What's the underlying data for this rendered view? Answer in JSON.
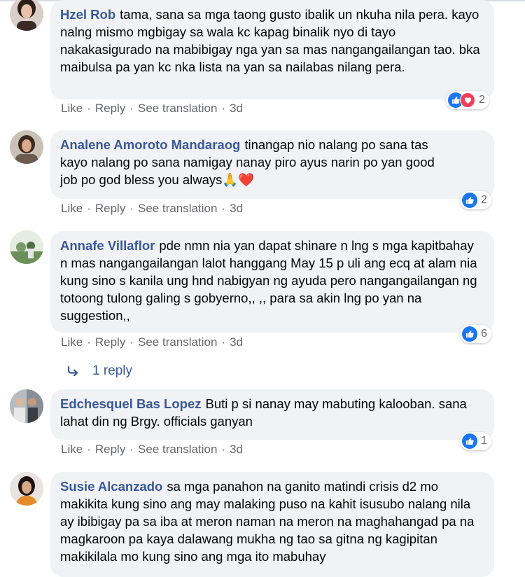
{
  "comments": [
    {
      "author": "Hzel Rob",
      "text": "tama, sana sa mga taong gusto ibalik un nkuha nila pera. kayo nalng mismo mgbigay sa wala kc kapag binalik nyo di tayo nakakasigurado na mabibigay nga yan sa mas nangangailangan tao. bka maibulsa pa yan kc nka lista na yan sa nailabas nilang pera.",
      "reactions": "2",
      "reaction_icons": [
        "like-icon",
        "love-icon"
      ],
      "time": "3d"
    },
    {
      "author": "Analene Amoroto Mandaraog",
      "text": "tinangap nio nalang po sana tas kayo nalang po sana namigay nanay piro ayus narin po yan good job po god bless you always🙏❤️",
      "reactions": "2",
      "reaction_icons": [
        "like-icon"
      ],
      "time": "3d"
    },
    {
      "author": "Annafe Villaflor",
      "text": "pde nmn nia yan dapat shinare n lng s mga kapitbahay n mas nangangailangan lalot hanggang May 15 p uli ang ecq at alam nia kung sino s kanila ung hnd nabigyan ng ayuda pero nangangailangan ng totoong tulong galing s gobyerno,, ,, para sa akin lng po yan na suggestion,,",
      "reactions": "6",
      "reaction_icons": [
        "like-icon"
      ],
      "time": "3d",
      "replies_label": "1 reply"
    },
    {
      "author": "Edchesquel Bas Lopez",
      "text": "Buti p si nanay may mabuting kalooban. sana lahat din ng Brgy. officials ganyan",
      "reactions": "1",
      "reaction_icons": [
        "like-icon"
      ],
      "time": "3d"
    },
    {
      "author": "Susie Alcanzado",
      "text": "sa mga panahon na ganito matindi crisis d2 mo makikita kung sino ang may malaking puso na kahit isusubo nalang nila ay ibibigay pa sa iba at meron naman na meron na maghahangad pa na magkaroon pa kaya dalawang mukha ng tao sa gitna ng kagipitan makikilala mo kung sino ang mga ito mabuhay",
      "time": ""
    }
  ],
  "actions": {
    "like": "Like",
    "reply": "Reply",
    "see_translation": "See translation",
    "separator": "·"
  },
  "colors": {
    "author": "#385898",
    "bubble": "#f0f2f5",
    "meta": "#65676b",
    "like": "#1877f2",
    "love": "#f33e58"
  }
}
